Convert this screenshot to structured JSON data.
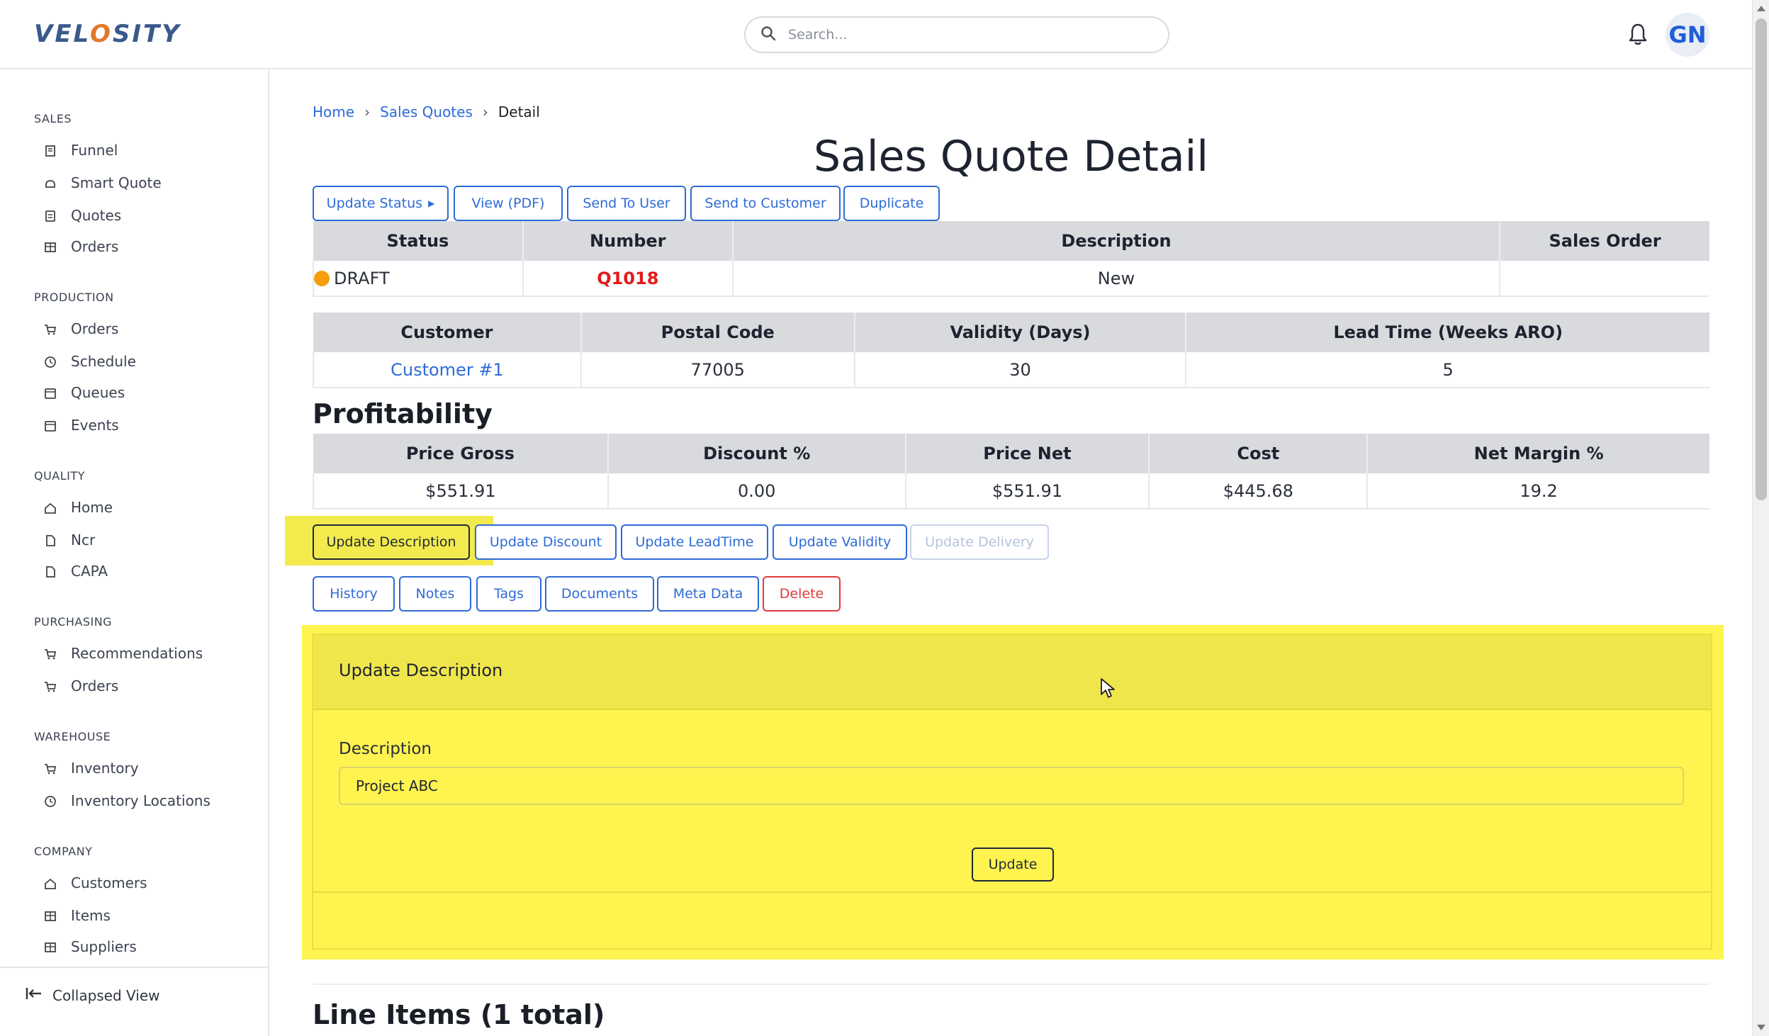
{
  "app": {
    "logo_text_pre": "VEL",
    "logo_text_o": "O",
    "logo_text_post": "SITY",
    "avatar_initials": "GN",
    "search_placeholder": "Search..."
  },
  "sidebar": {
    "sections": [
      {
        "title": "SALES",
        "items": [
          {
            "label": "Funnel",
            "icon": "building-icon"
          },
          {
            "label": "Smart Quote",
            "icon": "bell-icon"
          },
          {
            "label": "Quotes",
            "icon": "document-icon"
          },
          {
            "label": "Orders",
            "icon": "store-icon"
          }
        ]
      },
      {
        "title": "PRODUCTION",
        "items": [
          {
            "label": "Orders",
            "icon": "cart-icon"
          },
          {
            "label": "Schedule",
            "icon": "clock-icon"
          },
          {
            "label": "Queues",
            "icon": "calendar-icon"
          },
          {
            "label": "Events",
            "icon": "calendar-icon"
          }
        ]
      },
      {
        "title": "QUALITY",
        "items": [
          {
            "label": "Home",
            "icon": "home-icon"
          },
          {
            "label": "Ncr",
            "icon": "file-icon"
          },
          {
            "label": "CAPA",
            "icon": "file-icon"
          }
        ]
      },
      {
        "title": "PURCHASING",
        "items": [
          {
            "label": "Recommendations",
            "icon": "cart-icon"
          },
          {
            "label": "Orders",
            "icon": "cart-icon"
          }
        ]
      },
      {
        "title": "WAREHOUSE",
        "items": [
          {
            "label": "Inventory",
            "icon": "cart-icon"
          },
          {
            "label": "Inventory Locations",
            "icon": "clock-icon"
          }
        ]
      },
      {
        "title": "COMPANY",
        "items": [
          {
            "label": "Customers",
            "icon": "home-icon"
          },
          {
            "label": "Items",
            "icon": "store-icon"
          },
          {
            "label": "Suppliers",
            "icon": "store-icon"
          }
        ]
      }
    ],
    "collapse_label": "Collapsed View"
  },
  "breadcrumb": {
    "home": "Home",
    "parent": "Sales Quotes",
    "current": "Detail"
  },
  "page_title": "Sales Quote Detail",
  "actions": {
    "update_status": "Update Status",
    "view_pdf": "View (PDF)",
    "send_to_user": "Send To User",
    "send_to_customer": "Send to Customer",
    "duplicate": "Duplicate"
  },
  "summary": {
    "headers": [
      "Status",
      "Number",
      "Description",
      "Sales Order"
    ],
    "status": "DRAFT",
    "status_color": "#f59e0b",
    "number": "Q1018",
    "description": "New",
    "sales_order": ""
  },
  "customer_table": {
    "headers": [
      "Customer",
      "Postal Code",
      "Validity (Days)",
      "Lead Time (Weeks ARO)"
    ],
    "customer": "Customer #1",
    "postal_code": "77005",
    "validity": "30",
    "lead_time": "5"
  },
  "profitability": {
    "title": "Profitability",
    "headers": [
      "Price Gross",
      "Discount %",
      "Price Net",
      "Cost",
      "Net Margin %"
    ],
    "price_gross": "$551.91",
    "discount": "0.00",
    "price_net": "$551.91",
    "cost": "$445.68",
    "net_margin": "19.2"
  },
  "update_buttons": {
    "description": "Update Description",
    "discount": "Update Discount",
    "leadtime": "Update LeadTime",
    "validity": "Update Validity",
    "delivery": "Update Delivery"
  },
  "tabs": {
    "history": "History",
    "notes": "Notes",
    "tags": "Tags",
    "documents": "Documents",
    "meta_data": "Meta Data",
    "delete": "Delete"
  },
  "update_panel": {
    "title": "Update Description",
    "field_label": "Description",
    "field_value": "Project ABC",
    "submit": "Update"
  },
  "line_items_title": "Line Items (1 total)",
  "colors": {
    "accent": "#2e6bd8",
    "danger": "#e03b3b",
    "highlight": "#fff350"
  }
}
